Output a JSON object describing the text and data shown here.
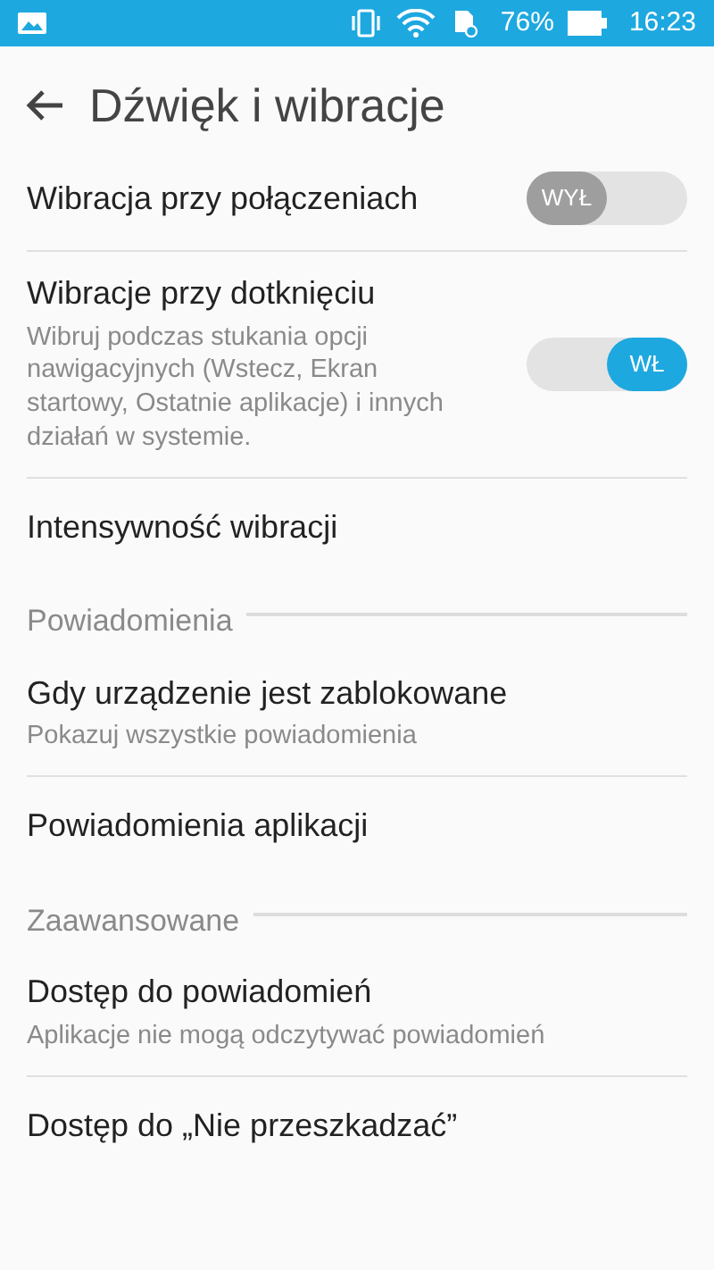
{
  "status_bar": {
    "battery": "76%",
    "time": "16:23"
  },
  "app_bar": {
    "title": "Dźwięk i wibracje"
  },
  "items": [
    {
      "kind": "setting",
      "title": "Wibracja przy połączeniach",
      "toggle": {
        "on": false,
        "label": "WYŁ"
      }
    },
    {
      "kind": "setting",
      "title": "Wibracje przy dotknięciu",
      "subtitle": "Wibruj podczas stukania opcji nawigacyjnych (Wstecz, Ekran startowy, Ostatnie aplikacje) i innych działań w systemie.",
      "toggle": {
        "on": true,
        "label": "WŁ"
      }
    },
    {
      "kind": "setting",
      "title": "Intensywność wibracji"
    },
    {
      "kind": "header",
      "title": "Powiadomienia"
    },
    {
      "kind": "setting",
      "title": "Gdy urządzenie jest zablokowane",
      "subtitle": "Pokazuj wszystkie powiadomienia"
    },
    {
      "kind": "setting",
      "title": "Powiadomienia aplikacji"
    },
    {
      "kind": "header",
      "title": "Zaawansowane"
    },
    {
      "kind": "setting",
      "title": "Dostęp do powiadomień",
      "subtitle": "Aplikacje nie mogą odczytywać powiadomień"
    },
    {
      "kind": "setting",
      "title": "Dostęp do „Nie przeszkadzać”"
    }
  ]
}
